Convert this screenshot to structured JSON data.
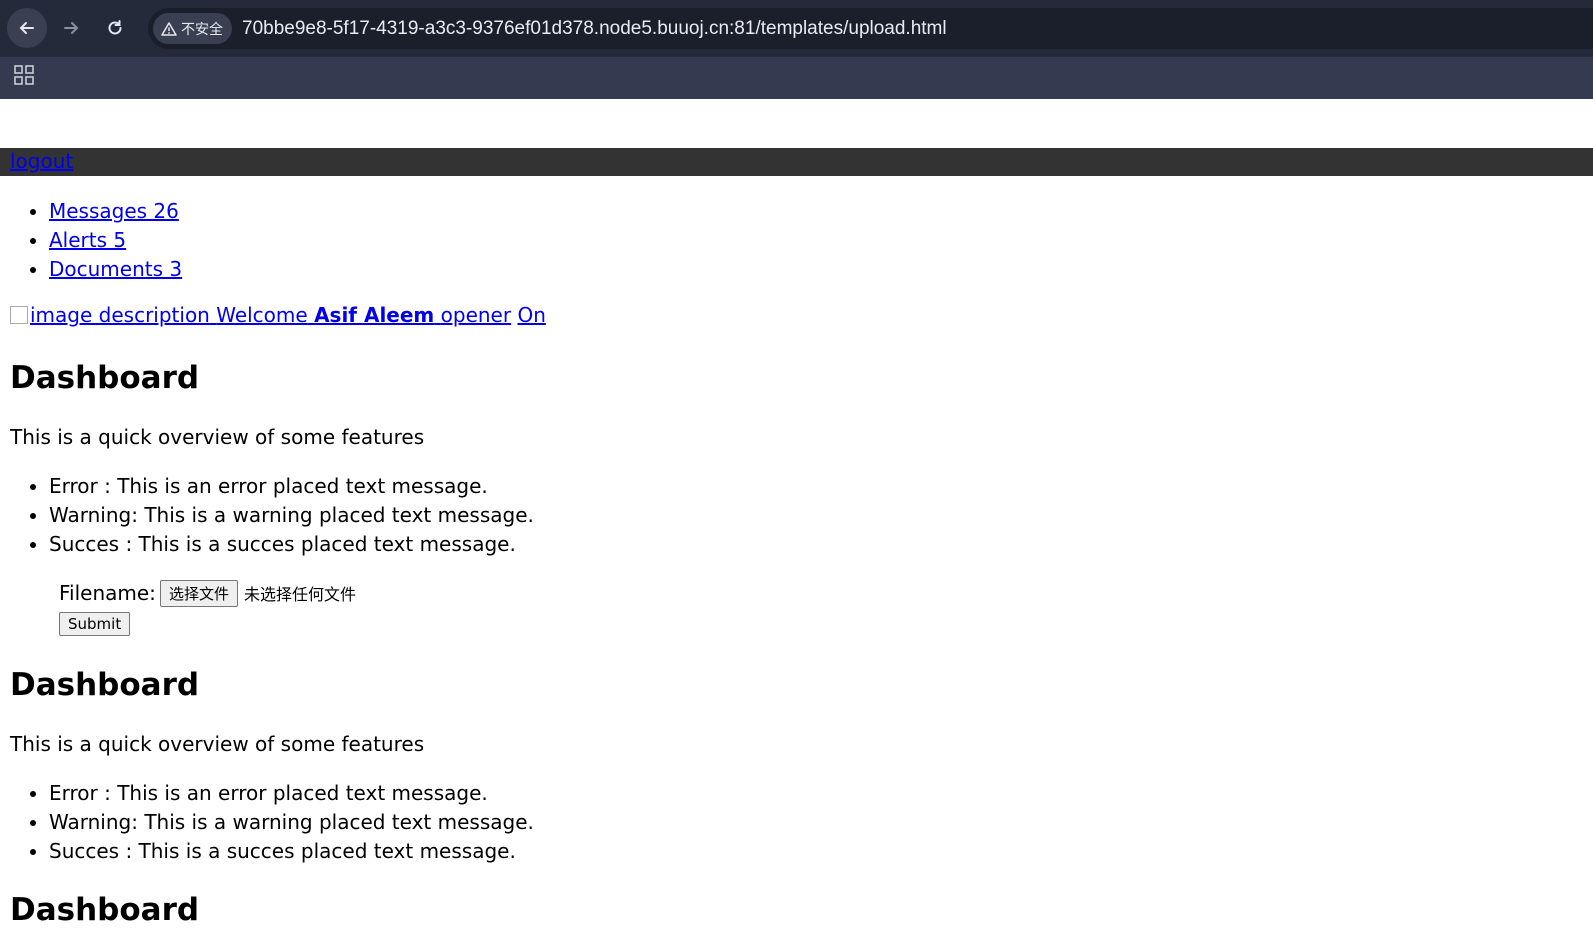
{
  "browser": {
    "security_label": "不安全",
    "url": "70bbe9e8-5f17-4319-a3c3-9376ef01d378.node5.buuoj.cn:81/templates/upload.html"
  },
  "topbar": {
    "logout_label": "logout"
  },
  "nav": [
    {
      "label": "Messages 26"
    },
    {
      "label": "Alerts 5"
    },
    {
      "label": "Documents 3"
    }
  ],
  "welcome": {
    "img_alt": "image description",
    "prefix": "Welcome",
    "name": "Asif Aleem",
    "opener": "opener",
    "on": "On"
  },
  "sections": [
    {
      "title": "Dashboard",
      "intro": "This is a quick overview of some features",
      "items": [
        "Error : This is an error placed text message.",
        "Warning: This is a warning placed text message.",
        "Succes : This is a succes placed text message."
      ]
    },
    {
      "title": "Dashboard",
      "intro": "This is a quick overview of some features",
      "items": [
        "Error : This is an error placed text message.",
        "Warning: This is a warning placed text message.",
        "Succes : This is a succes placed text message."
      ]
    },
    {
      "title": "Dashboard"
    }
  ],
  "form": {
    "filename_label": "Filename:",
    "choose_file_label": "选择文件",
    "no_file_label": "未选择任何文件",
    "submit_label": "Submit"
  }
}
